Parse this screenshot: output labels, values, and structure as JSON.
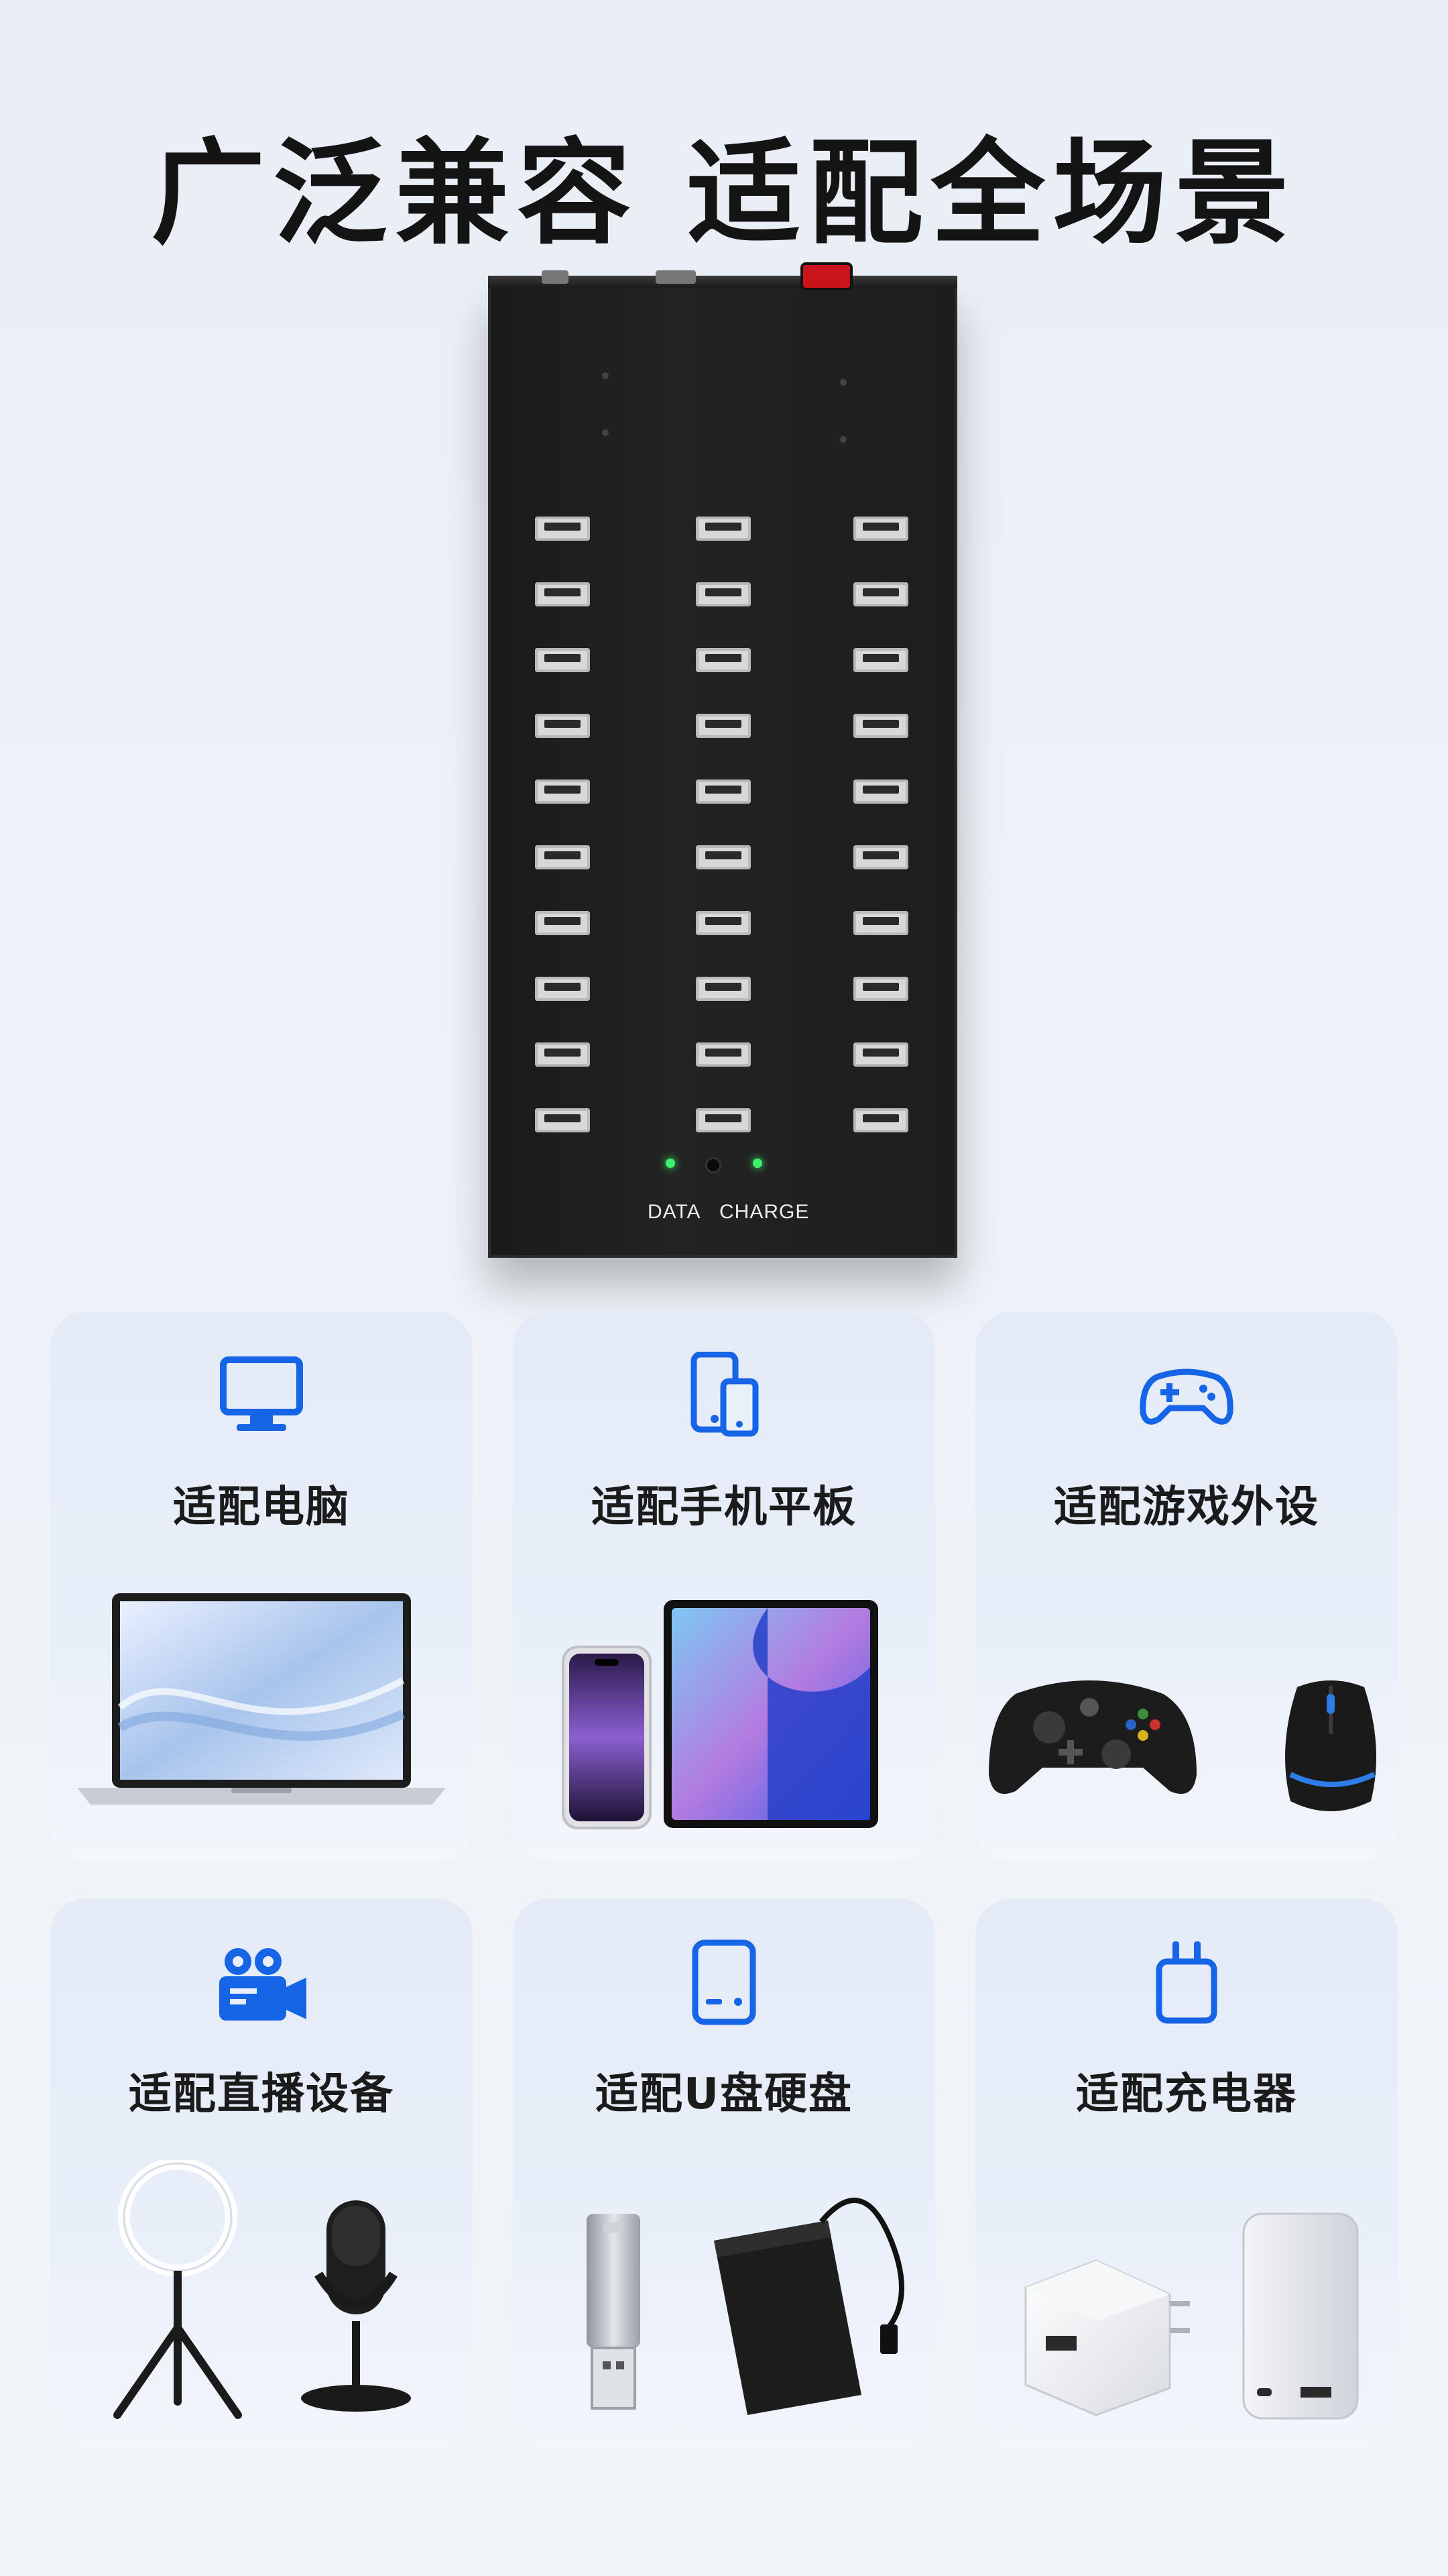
{
  "headline": "广泛兼容 适配全场景",
  "device": {
    "data_label": "DATA",
    "charge_label": "CHARGE",
    "port_columns": 3,
    "port_rows": 10
  },
  "cards": [
    {
      "title": "适配电脑",
      "icon": "monitor-icon",
      "illustration": "laptop"
    },
    {
      "title": "适配手机平板",
      "icon": "phone-tablet-icon",
      "illustration": "phone-and-tablet"
    },
    {
      "title": "适配游戏外设",
      "icon": "gamepad-icon",
      "illustration": "controller-and-mouse"
    },
    {
      "title": "适配直播设备",
      "icon": "video-camera-icon",
      "illustration": "ring-light-and-microphone"
    },
    {
      "title": "适配U盘硬盘",
      "icon": "hard-drive-icon",
      "illustration": "usb-drive-and-hdd"
    },
    {
      "title": "适配充电器",
      "icon": "plug-icon",
      "illustration": "charger-and-power-bank"
    }
  ],
  "colors": {
    "accent": "#1565e6",
    "headline": "#141414"
  }
}
